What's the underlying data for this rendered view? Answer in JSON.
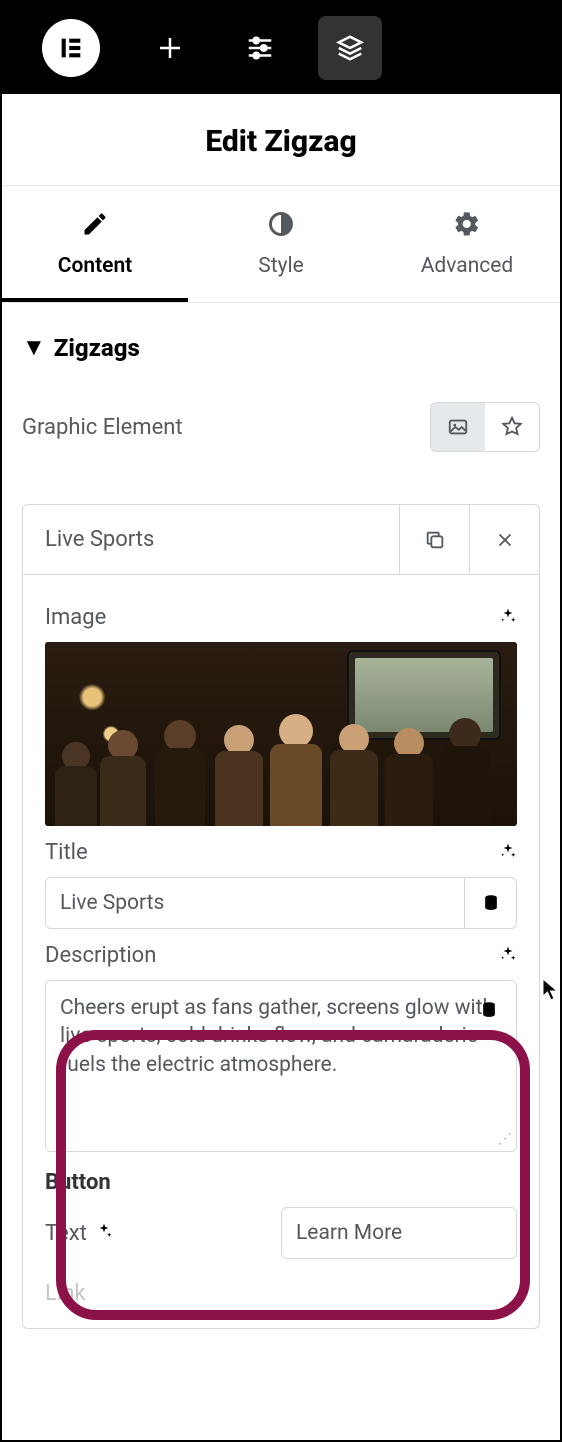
{
  "topbar": {
    "icons": [
      "plus-icon",
      "settings-icon",
      "layers-icon"
    ]
  },
  "panel_title": "Edit Zigzag",
  "tabs": {
    "content": "Content",
    "style": "Style",
    "advanced": "Advanced",
    "active": "content"
  },
  "section": {
    "title": "Zigzags",
    "graphic_element_label": "Graphic Element"
  },
  "item": {
    "header_title": "Live Sports",
    "image_label": "Image",
    "title_label": "Title",
    "title_value": "Live Sports",
    "description_label": "Description",
    "description_value": "Cheers erupt as fans gather, screens glow with live sports, cold drinks flow, and camaraderie fuels the electric atmosphere.",
    "button_label": "Button",
    "button_text_label": "Text",
    "button_text_value": "Learn More",
    "link_label": "Link"
  }
}
